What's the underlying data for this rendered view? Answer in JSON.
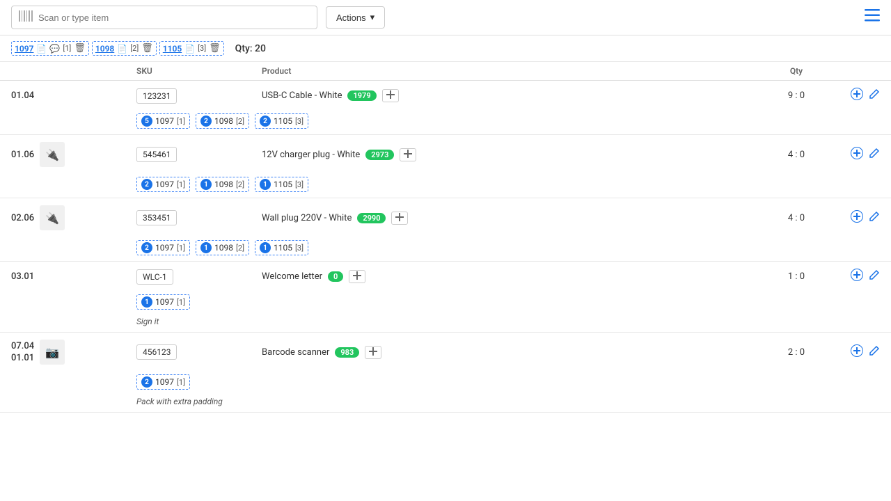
{
  "topbar": {
    "scan_placeholder": "Scan or type item",
    "actions_label": "Actions",
    "qty_label": "Qty: 20"
  },
  "order_tabs": [
    {
      "id": "1097",
      "icons": [
        "file",
        "chat"
      ],
      "counts": [
        "",
        "[1]"
      ],
      "delete": true
    },
    {
      "id": "1098",
      "icons": [
        "file"
      ],
      "counts": [
        "[2]"
      ],
      "delete": true
    },
    {
      "id": "1105",
      "icons": [
        "file"
      ],
      "counts": [
        "[3]"
      ],
      "delete": true
    }
  ],
  "table_headers": {
    "col1": "",
    "col2": "SKU",
    "col3": "Product",
    "col4": "Qty",
    "col5": ""
  },
  "products": [
    {
      "location": "01.04",
      "has_image": false,
      "sku": "123231",
      "product_name": "USB-C Cable - White",
      "badge": "1979",
      "qty": "9 : 0",
      "orders": [
        {
          "num": "5",
          "id": "1097",
          "count": "[1]"
        },
        {
          "num": "2",
          "id": "1098",
          "count": "[2]"
        },
        {
          "num": "2",
          "id": "1105",
          "count": "[3]"
        }
      ],
      "note": ""
    },
    {
      "location": "01.06",
      "has_image": true,
      "image_char": "🔌",
      "sku": "545461",
      "product_name": "12V charger plug - White",
      "badge": "2973",
      "qty": "4 : 0",
      "orders": [
        {
          "num": "2",
          "id": "1097",
          "count": "[1]"
        },
        {
          "num": "1",
          "id": "1098",
          "count": "[2]"
        },
        {
          "num": "1",
          "id": "1105",
          "count": "[3]"
        }
      ],
      "note": ""
    },
    {
      "location": "02.06",
      "has_image": true,
      "image_char": "🔌",
      "sku": "353451",
      "product_name": "Wall plug 220V - White",
      "badge": "2990",
      "qty": "4 : 0",
      "orders": [
        {
          "num": "2",
          "id": "1097",
          "count": "[1]"
        },
        {
          "num": "1",
          "id": "1098",
          "count": "[2]"
        },
        {
          "num": "1",
          "id": "1105",
          "count": "[3]"
        }
      ],
      "note": ""
    },
    {
      "location": "03.01",
      "has_image": false,
      "sku": "WLC-1",
      "product_name": "Welcome letter",
      "badge": "0",
      "badge_type": "zero",
      "qty": "1 : 0",
      "orders": [
        {
          "num": "1",
          "id": "1097",
          "count": "[1]"
        }
      ],
      "note": "Sign it"
    },
    {
      "location": "07.04 / 01.01",
      "location_line1": "07.04",
      "location_line2": "01.01",
      "has_image": true,
      "image_char": "📷",
      "sku": "456123",
      "product_name": "Barcode scanner",
      "badge": "983",
      "qty": "2 : 0",
      "orders": [
        {
          "num": "2",
          "id": "1097",
          "count": "[1]"
        }
      ],
      "note": "Pack with extra padding"
    }
  ]
}
